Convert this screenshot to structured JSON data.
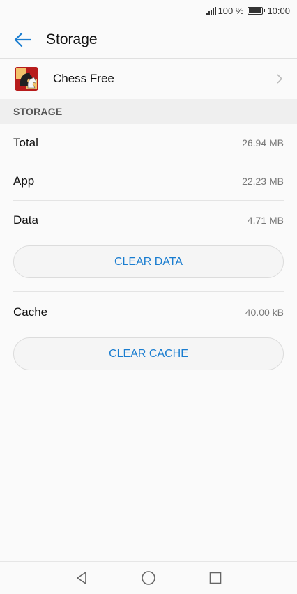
{
  "status_bar": {
    "battery": "100 %",
    "time": "10:00"
  },
  "app_bar": {
    "title": "Storage"
  },
  "app": {
    "name": "Chess Free"
  },
  "section": {
    "heading": "STORAGE"
  },
  "rows": {
    "total": {
      "label": "Total",
      "value": "26.94 MB"
    },
    "app": {
      "label": "App",
      "value": "22.23 MB"
    },
    "data": {
      "label": "Data",
      "value": "4.71 MB"
    },
    "cache": {
      "label": "Cache",
      "value": "40.00 kB"
    }
  },
  "buttons": {
    "clear_data": "CLEAR DATA",
    "clear_cache": "CLEAR CACHE"
  },
  "colors": {
    "accent": "#1a7dd0",
    "section_bg": "#efefef"
  }
}
